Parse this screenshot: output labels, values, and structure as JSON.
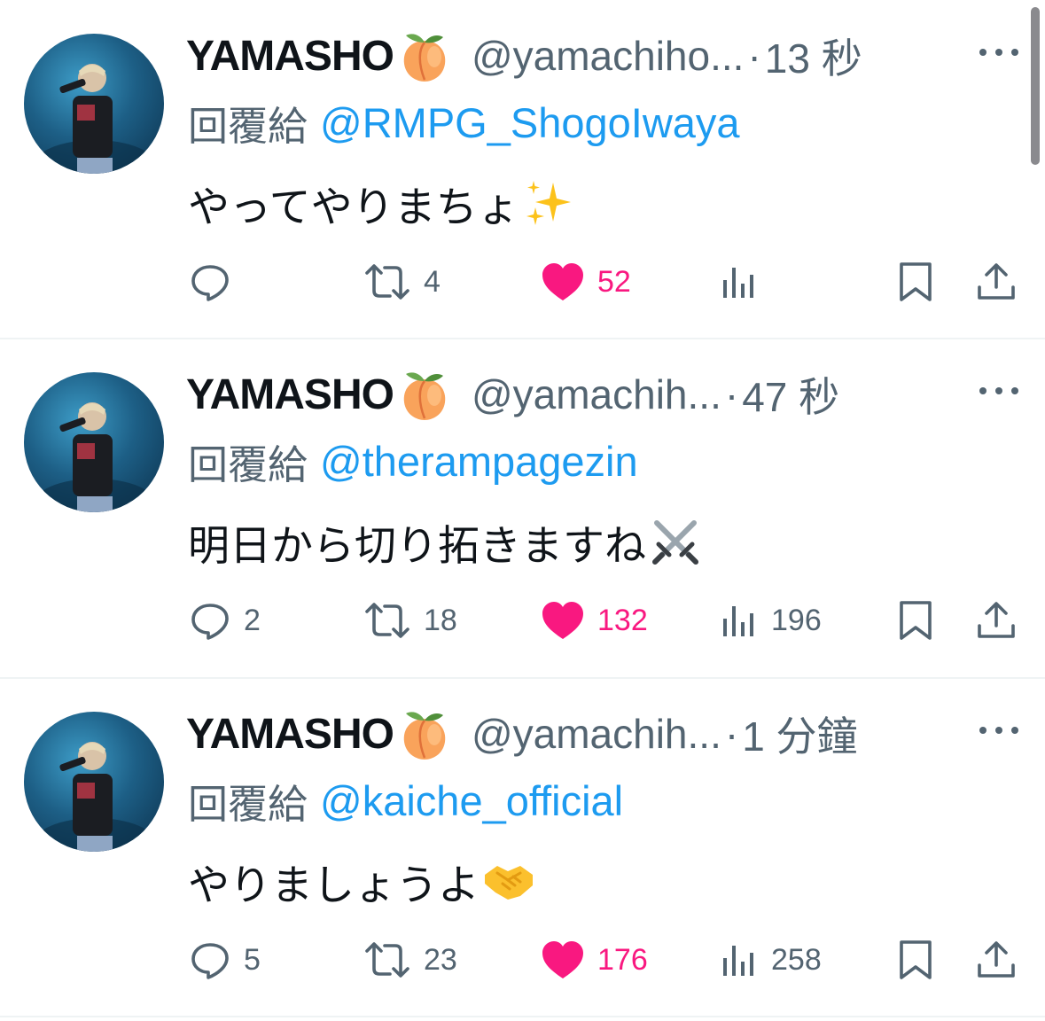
{
  "colors": {
    "text": "#0f1419",
    "secondary": "#536471",
    "link": "#1d9bf0",
    "like": "#f91880",
    "divider": "#eff3f4"
  },
  "tweets": [
    {
      "display_name": "YAMASHO",
      "name_emoji": "peach-emoji",
      "handle": "@yamachiho...",
      "separator": "·",
      "time": "13 秒",
      "reply_prefix": "回覆給",
      "reply_to": "@RMPG_ShogoIwaya",
      "text": "やってやりまちょ",
      "text_emoji": "sparkles-emoji",
      "replies": "",
      "retweets": "4",
      "likes": "52",
      "views": ""
    },
    {
      "display_name": "YAMASHO",
      "name_emoji": "peach-emoji",
      "handle": "@yamachih...",
      "separator": "·",
      "time": "47 秒",
      "reply_prefix": "回覆給",
      "reply_to": "@therampagezin",
      "text": "明日から切り拓きますね",
      "text_emoji": "crossed-swords-emoji",
      "replies": "2",
      "retweets": "18",
      "likes": "132",
      "views": "196"
    },
    {
      "display_name": "YAMASHO",
      "name_emoji": "peach-emoji",
      "handle": "@yamachih...",
      "separator": "·",
      "time": "1 分鐘",
      "reply_prefix": "回覆給",
      "reply_to": "@kaiche_official",
      "text": "やりましょうよ",
      "text_emoji": "handshake-emoji",
      "replies": "5",
      "retweets": "23",
      "likes": "176",
      "views": "258"
    }
  ]
}
